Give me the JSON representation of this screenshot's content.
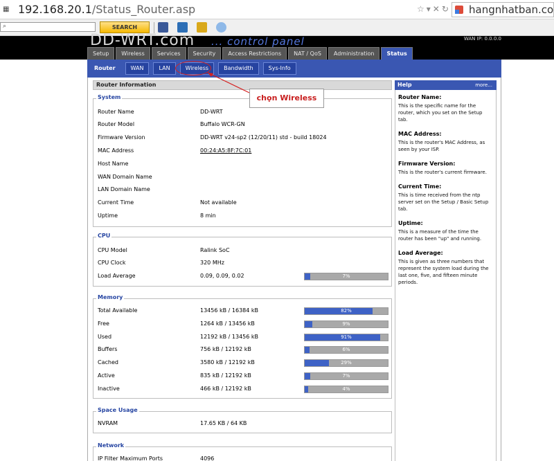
{
  "browser": {
    "url_host": "192.168.20.1",
    "url_path": "/Status_Router.asp",
    "search_engine_text": "hangnhatban.com"
  },
  "toolbar": {
    "search_button_label": "SEARCH"
  },
  "header": {
    "logo_text": "DD-WRT.com",
    "logo_tagline": "... control panel",
    "wan_ip_text": "WAN IP: 0.0.0.0"
  },
  "top_nav": [
    "Setup",
    "Wireless",
    "Services",
    "Security",
    "Access Restrictions",
    "NAT / QoS",
    "Administration",
    "Status"
  ],
  "sub_nav": [
    "Router",
    "WAN",
    "LAN",
    "Wireless",
    "Bandwidth",
    "Sys-Info"
  ],
  "annotation": {
    "text": "chọn Wireless",
    "color": "#c81e1e"
  },
  "content": {
    "title": "Router Information",
    "system": {
      "legend": "System",
      "rows": [
        {
          "label": "Router Name",
          "value": "DD-WRT"
        },
        {
          "label": "Router Model",
          "value": "Buffalo WCR-GN"
        },
        {
          "label": "Firmware Version",
          "value": "DD-WRT v24-sp2 (12/20/11) std - build 18024"
        },
        {
          "label": "MAC Address",
          "value": "00:24:A5:8F:7C:01"
        },
        {
          "label": "Host Name",
          "value": ""
        },
        {
          "label": "WAN Domain Name",
          "value": ""
        },
        {
          "label": "LAN Domain Name",
          "value": ""
        },
        {
          "label": "Current Time",
          "value": "Not available"
        },
        {
          "label": "Uptime",
          "value": "8 min"
        }
      ]
    },
    "cpu": {
      "legend": "CPU",
      "rows": [
        {
          "label": "CPU Model",
          "value": "Ralink SoC"
        },
        {
          "label": "CPU Clock",
          "value": "320 MHz"
        },
        {
          "label": "Load Average",
          "value": "0.09, 0.09, 0.02",
          "pct": 7,
          "pct_label": "7%"
        }
      ]
    },
    "memory": {
      "legend": "Memory",
      "rows": [
        {
          "label": "Total Available",
          "value": "13456 kB / 16384 kB",
          "pct": 82,
          "pct_label": "82%"
        },
        {
          "label": "Free",
          "value": "1264 kB / 13456 kB",
          "pct": 9,
          "pct_label": "9%"
        },
        {
          "label": "Used",
          "value": "12192 kB / 13456 kB",
          "pct": 91,
          "pct_label": "91%"
        },
        {
          "label": "Buffers",
          "value": "756 kB / 12192 kB",
          "pct": 6,
          "pct_label": "6%"
        },
        {
          "label": "Cached",
          "value": "3580 kB / 12192 kB",
          "pct": 29,
          "pct_label": "29%"
        },
        {
          "label": "Active",
          "value": "835 kB / 12192 kB",
          "pct": 7,
          "pct_label": "7%"
        },
        {
          "label": "Inactive",
          "value": "466 kB / 12192 kB",
          "pct": 4,
          "pct_label": "4%"
        }
      ]
    },
    "space": {
      "legend": "Space Usage",
      "rows": [
        {
          "label": "NVRAM",
          "value": "17.65 KB / 64 KB"
        }
      ]
    },
    "network": {
      "legend": "Network",
      "rows": [
        {
          "label": "IP Filter Maximum Ports",
          "value": "4096"
        }
      ]
    }
  },
  "help": {
    "title": "Help",
    "more": "more...",
    "items": [
      {
        "title": "Router Name:",
        "text": "This is the specific name for the router, which you set on the Setup tab."
      },
      {
        "title": "MAC Address:",
        "text": "This is the router's MAC Address, as seen by your ISP."
      },
      {
        "title": "Firmware Version:",
        "text": "This is the router's current firmware."
      },
      {
        "title": "Current Time:",
        "text": "This is time received from the ntp server set on the Setup / Basic Setup tab."
      },
      {
        "title": "Uptime:",
        "text": "This is a measure of the time the router has been \"up\" and running."
      },
      {
        "title": "Load Average:",
        "text": "This is given as three numbers that represent the system load during the last one, five, and fifteen minute periods."
      }
    ]
  },
  "colors": {
    "nav_blue": "#3a57b2",
    "bar_fill": "#3e62c6",
    "bar_bg": "#a9a9a9",
    "legend_blue": "#2645a2"
  }
}
